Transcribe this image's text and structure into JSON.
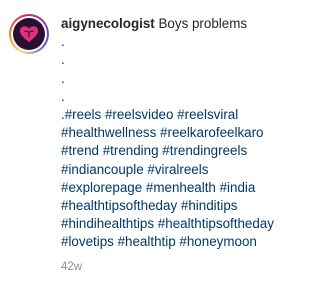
{
  "post": {
    "username": "aigynecologist",
    "title": "Boys problems",
    "dots": [
      ".",
      ".",
      ".",
      "."
    ],
    "hashtags": [
      "#reels",
      "#reelsvideo",
      "#reelsviral",
      "#healthwellness",
      "#reelkarofeelkaro",
      "#trend",
      "#trending",
      "#trendingreels",
      "#indiancouple",
      "#viralreels",
      "#explorepage",
      "#menhealth",
      "#india",
      "#healthtipsoftheday",
      "#hinditips",
      "#hindihealthtips",
      "#healthtipsoftheday",
      "#lovetips",
      "#healthtip",
      "#honeymoon"
    ],
    "first_tag_prefix": ".",
    "age": "42w"
  },
  "avatar": {
    "icon": "heart-uterus-logo-icon",
    "bg_color": "#2a1030",
    "icon_color": "#e0307a"
  },
  "colors": {
    "hashtag": "#00376b",
    "text": "#262626",
    "meta": "#8e8e8e"
  }
}
